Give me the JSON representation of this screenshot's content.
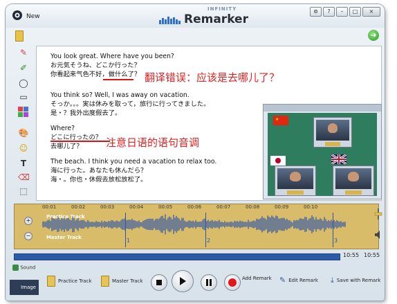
{
  "title_bar": {
    "new_label": "New",
    "logo_small": "INFINITY",
    "logo_brand": "Remarker"
  },
  "window_controls": [
    "⊚",
    "?",
    "–",
    "□",
    "×"
  ],
  "document": {
    "paragraphs": [
      [
        "You look great. Where have you been?",
        "お元気そうね、どこか行った？",
        "你看起来气色不好，做什么了？"
      ],
      [
        "You think so? Well, I was away on vacation.",
        "そっか。。。実は休みを取って，旅行に行ってきました。",
        "是・？我外出度假去了。"
      ],
      [
        "Where?",
        "どこに行ったの？",
        "去哪儿了？"
      ],
      [
        "The beach. I think you need a vacation to relax too.",
        "海に行った。あなたも休んだら？",
        "海・。你也・休假去放松放松了。"
      ]
    ],
    "remarks": [
      "翻译错误：应该是去哪儿了？",
      "注意日语的语句音调"
    ]
  },
  "waveform": {
    "track_label_top": "Practice Track",
    "track_label_bottom": "Master Track",
    "ruler": [
      "00:01",
      "00:02",
      "00:03",
      "00:04",
      "00:05",
      "00:06",
      "00:07",
      "00:08",
      "00:09",
      "00:10"
    ],
    "markers": [
      "1",
      "2",
      "3"
    ],
    "marker_positions": [
      0.3,
      0.53,
      0.82
    ]
  },
  "timeline": {
    "current": "10:55",
    "total": "10:55"
  },
  "left_nav": {
    "sound": "Sound",
    "image": "Image"
  },
  "bottom_bar": {
    "practice_track": "Practice Track",
    "master_track": "Master Track",
    "add_remark": "Add Remark",
    "edit_remark": "Edit Remark",
    "save_with_remark": "Save with Remark"
  },
  "icons": [
    "app-icon",
    "folder-icon",
    "go-icon",
    "pencil-icon",
    "highlighter-icon",
    "ellipse-icon",
    "rectangle-icon",
    "color-palette-icon",
    "paint-icon",
    "emoji-icon",
    "text-icon",
    "eraser-icon",
    "select-icon",
    "stop-icon",
    "play-icon",
    "pause-icon",
    "record-icon"
  ],
  "colors": {
    "accent": "#2a5aa8",
    "remark": "#e52020",
    "waveform": "#2a55a8",
    "track_bg": "#d9bc6a"
  }
}
